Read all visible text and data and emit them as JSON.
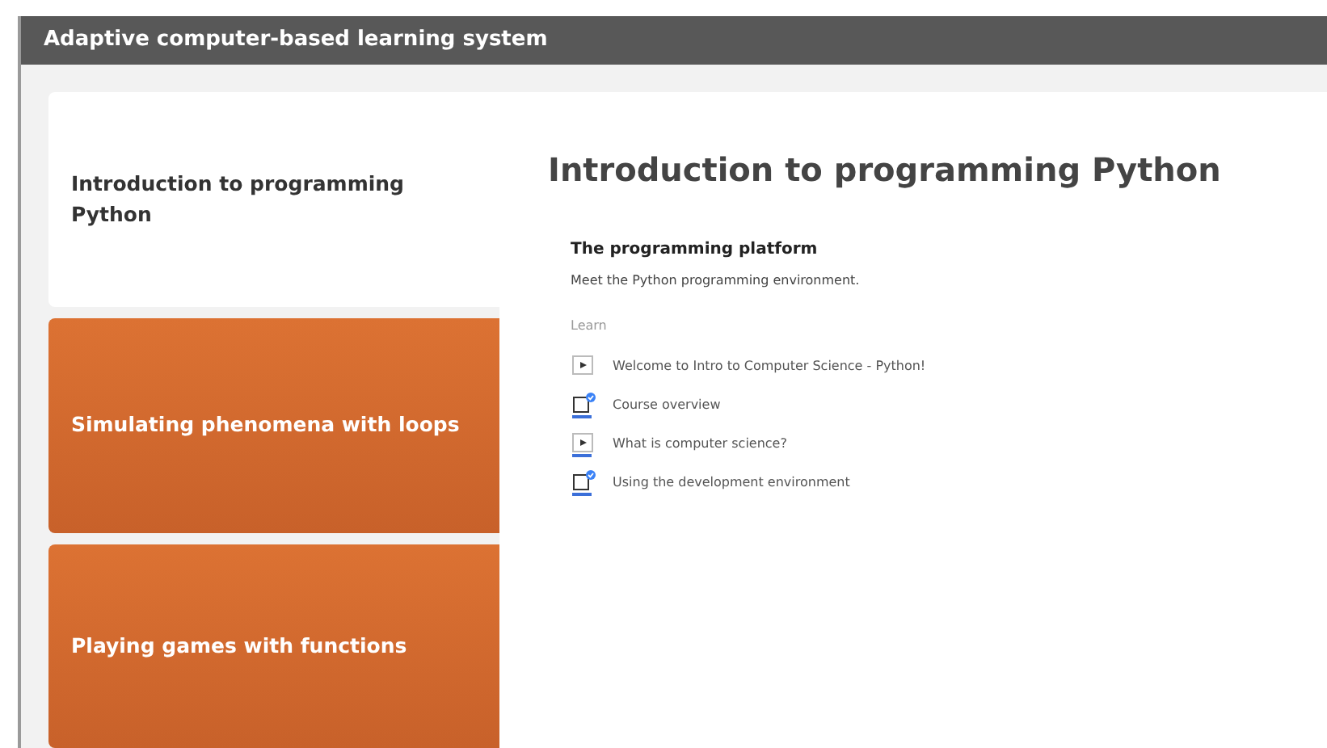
{
  "window": {
    "title": "Adaptive computer-based learning system"
  },
  "units": [
    {
      "title": "Introduction to programming Python",
      "selected": true
    },
    {
      "title": "Simulating phenomena with loops",
      "selected": false
    },
    {
      "title": "Playing games with functions",
      "selected": false
    }
  ],
  "content": {
    "heading": "Introduction to programming Python",
    "section": {
      "title": "The programming platform",
      "description": "Meet the Python programming environment.",
      "group_label": "Learn",
      "items": [
        {
          "kind": "video",
          "label": "Welcome to Intro to Computer Science - Python!",
          "completed": false
        },
        {
          "kind": "article",
          "label": "Course overview",
          "completed": true
        },
        {
          "kind": "video",
          "label": "What is computer science?",
          "completed": true
        },
        {
          "kind": "article",
          "label": "Using the development environment",
          "completed": true
        }
      ]
    }
  }
}
